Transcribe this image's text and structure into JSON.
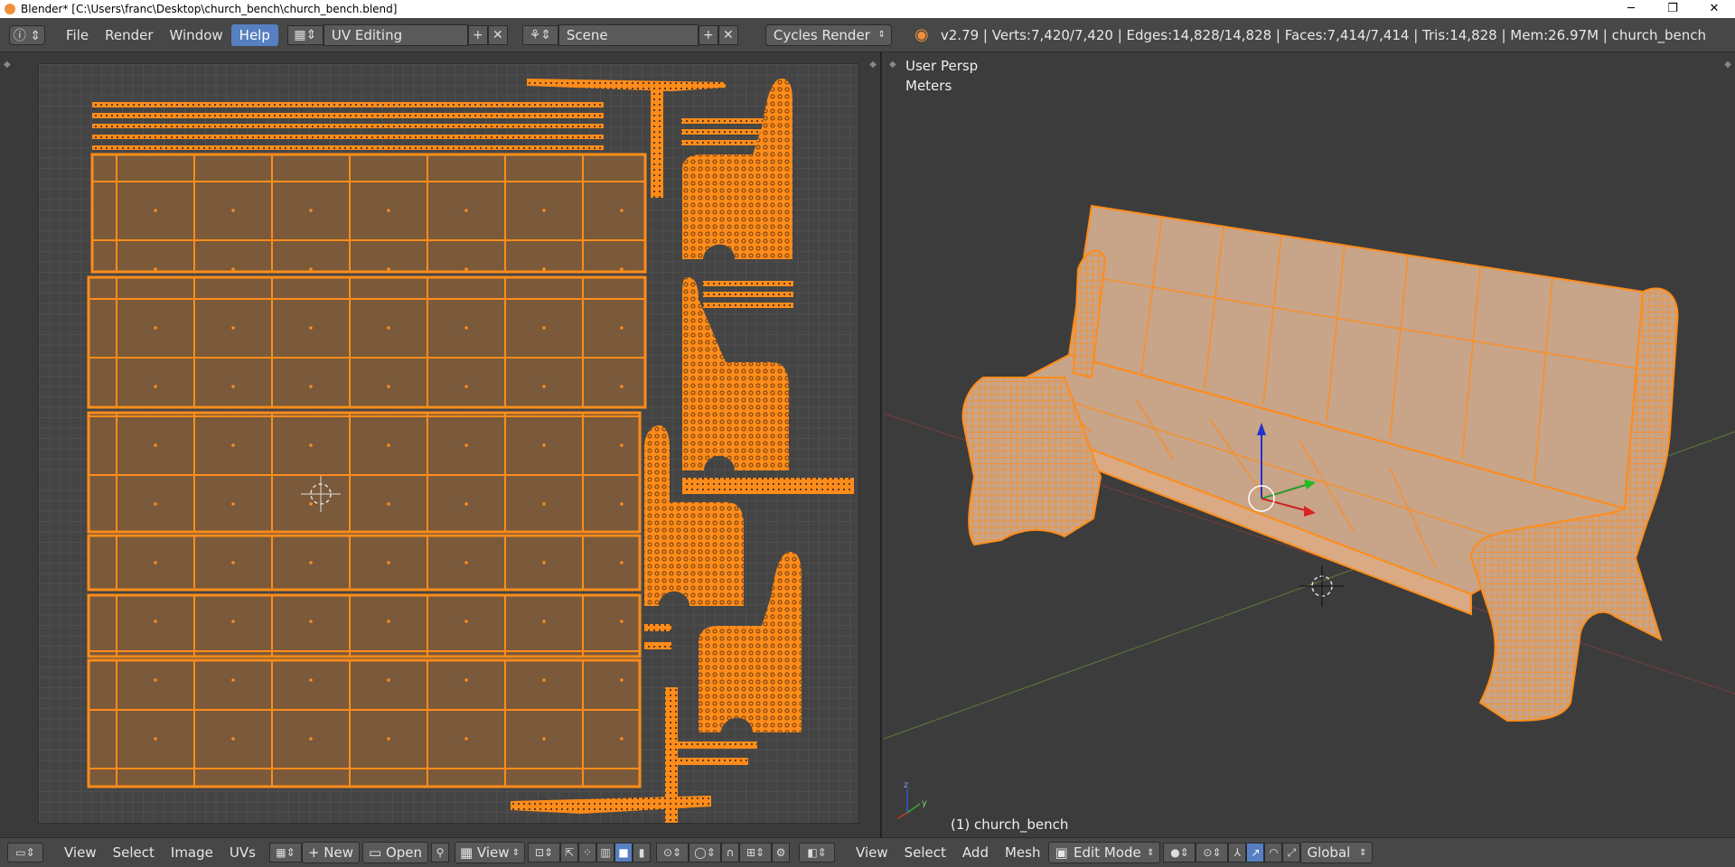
{
  "window": {
    "title": "Blender* [C:\\Users\\franc\\Desktop\\church_bench\\church_bench.blend]",
    "minimize": "─",
    "restore": "❐",
    "close": "✕"
  },
  "info_header": {
    "menus": [
      "File",
      "Render",
      "Window",
      "Help"
    ],
    "active_menu": "Help",
    "screen_layout": "UV Editing",
    "scene": "Scene",
    "render_engine": "Cycles Render",
    "stats": "v2.79 | Verts:7,420/7,420 | Edges:14,828/14,828 | Faces:7,414/7,414 | Tris:14,828 | Mem:26.97M | church_bench"
  },
  "viewport": {
    "view_label": "User Persp",
    "units_label": "Meters",
    "object_label": "(1) church_bench",
    "colors": {
      "wire": "#ff8c1a",
      "face": "#c8a488",
      "background": "#3c3c3c"
    }
  },
  "uv_editor": {
    "colors": {
      "island_fill": "#7a5a3a",
      "island_edge": "#ff8c1a",
      "grid": "#4e4e4e"
    }
  },
  "uv_footer": {
    "menus": [
      "View",
      "Select",
      "Image",
      "UVs"
    ],
    "new_label": "New",
    "open_label": "Open",
    "view_label": "View"
  },
  "view3d_footer": {
    "menus": [
      "View",
      "Select",
      "Add",
      "Mesh"
    ],
    "mode": "Edit Mode",
    "orientation": "Global"
  },
  "icons": [
    "info-icon",
    "screen-layout-icon",
    "scene-icon",
    "blender-logo-icon",
    "image-editor-icon",
    "view3d-icon",
    "pin-icon",
    "cursor-icon",
    "manipulator-icon"
  ]
}
